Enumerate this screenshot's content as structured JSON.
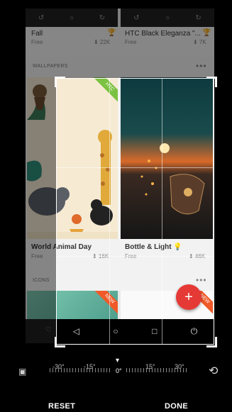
{
  "top_tiles": [
    {
      "title": "Fall",
      "price": "Free",
      "downloads": "⬇ 22K"
    },
    {
      "title": "HTC Black Eleganza \"...",
      "price": "Free",
      "downloads": "⬇ 7K"
    }
  ],
  "sections": {
    "wallpapers": "WALLPAPERS",
    "icons": "ICONS",
    "more": "•••"
  },
  "wallpapers": [
    {
      "title": "World Animal Day",
      "price": "Free",
      "downloads": "⬇ 16K",
      "ribbon": "HTC"
    },
    {
      "title": "Bottle & Light 💡",
      "price": "Free",
      "downloads": "⬇ 46K"
    }
  ],
  "icons_ribbon": "NEW",
  "fab": "+",
  "nav_icons": [
    "back-icon",
    "home-icon",
    "recents-icon",
    "power-icon"
  ],
  "nav_glyphs": [
    "◁",
    "○",
    "□",
    "⏻"
  ],
  "rotation": {
    "labels": [
      "-30°",
      "-15°",
      "0°",
      "15°",
      "30°"
    ],
    "pointer": "▾"
  },
  "aspect_icon": "▣",
  "rotate_icon": "⟲",
  "actions": {
    "reset": "RESET",
    "done": "DONE"
  }
}
